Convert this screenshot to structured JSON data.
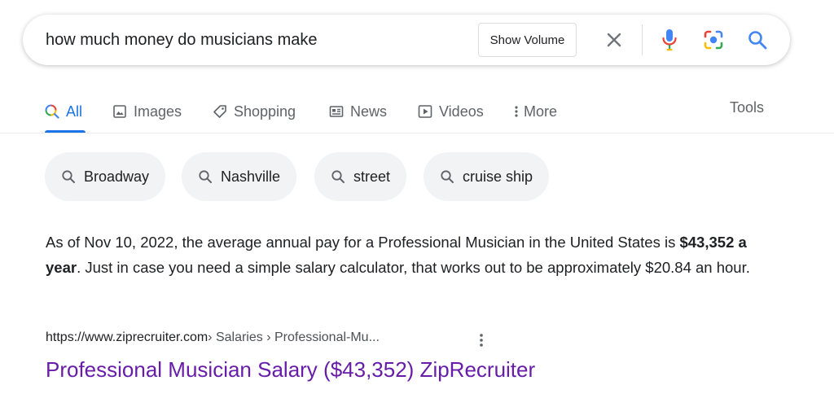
{
  "search": {
    "query": "how much money do musicians make",
    "show_volume_label": "Show Volume"
  },
  "tabs": [
    {
      "label": "All",
      "icon": "search-icon",
      "active": true
    },
    {
      "label": "Images",
      "icon": "image-icon"
    },
    {
      "label": "Shopping",
      "icon": "tag-icon"
    },
    {
      "label": "News",
      "icon": "news-icon"
    },
    {
      "label": "Videos",
      "icon": "play-icon"
    },
    {
      "label": "More",
      "icon": "more-vert-icon"
    }
  ],
  "tools_label": "Tools",
  "chips": [
    {
      "label": "Broadway"
    },
    {
      "label": "Nashville"
    },
    {
      "label": "street"
    },
    {
      "label": "cruise ship"
    }
  ],
  "snippet": {
    "before": "As of Nov 10, 2022, the average annual pay for a Professional Musician in the United States is ",
    "bold": "$43,352 a year",
    "after": ". Just in case you need a simple salary calculator, that works out to be approximately $20.84 an hour."
  },
  "result": {
    "url": "https://www.ziprecruiter.com",
    "path": " › Salaries › Professional-Mu...",
    "title": "Professional Musician Salary ($43,352) ZipRecruiter"
  },
  "colors": {
    "accent": "#1a73e8",
    "visited_link": "#681da8",
    "chip_bg": "#f1f3f4"
  }
}
